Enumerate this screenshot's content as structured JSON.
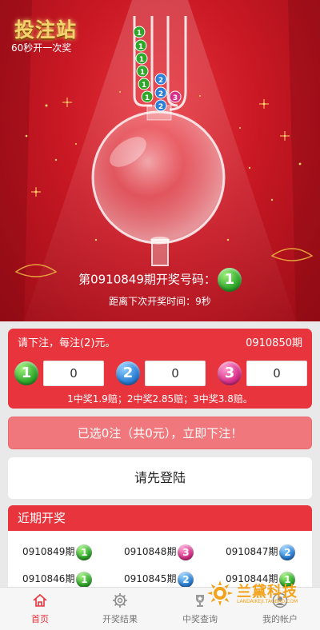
{
  "header": {
    "logo_text": "投注站",
    "subtitle": "60秒开一次奖"
  },
  "machine": {
    "tube_balls": [
      "1",
      "1",
      "1",
      "1",
      "1",
      "1",
      "2",
      "2",
      "2",
      "3"
    ]
  },
  "draw": {
    "title": "第0910849期开奖号码：",
    "result_ball": "1",
    "countdown": "距离下次开奖时间：9秒"
  },
  "bet": {
    "instruction": "请下注，每注(2)元。",
    "period": "0910850期",
    "options": [
      {
        "ball": "1",
        "value": "0"
      },
      {
        "ball": "2",
        "value": "0"
      },
      {
        "ball": "3",
        "value": "0"
      }
    ],
    "odds": "1中奖1.9赔；2中奖2.85赔；3中奖3.8赔。"
  },
  "submit_label": "已选0注（共0元），立即下注！",
  "login_label": "请先登陆",
  "recent": {
    "title": "近期开奖",
    "items": [
      {
        "period": "0910849期",
        "ball": "1"
      },
      {
        "period": "0910848期",
        "ball": "3"
      },
      {
        "period": "0910847期",
        "ball": "2"
      },
      {
        "period": "0910846期",
        "ball": "1"
      },
      {
        "period": "0910845期",
        "ball": "2"
      },
      {
        "period": "0910844期",
        "ball": "1"
      }
    ]
  },
  "watermark": {
    "text": "兰黛科技",
    "sub": "LANDAIKEJI.TAOBAO.COM"
  },
  "tabs": [
    {
      "label": "首页",
      "icon": "home-icon",
      "active": true
    },
    {
      "label": "开奖结果",
      "icon": "gear-icon",
      "active": false
    },
    {
      "label": "中奖查询",
      "icon": "trophy-icon",
      "active": false
    },
    {
      "label": "我的帐户",
      "icon": "user-icon",
      "active": false
    }
  ],
  "colors": {
    "brand_red": "#e8353d",
    "ball_1": "#2fa72b",
    "ball_2": "#2b7fd6",
    "ball_3": "#d8308a",
    "active_tab": "#e8353d"
  }
}
